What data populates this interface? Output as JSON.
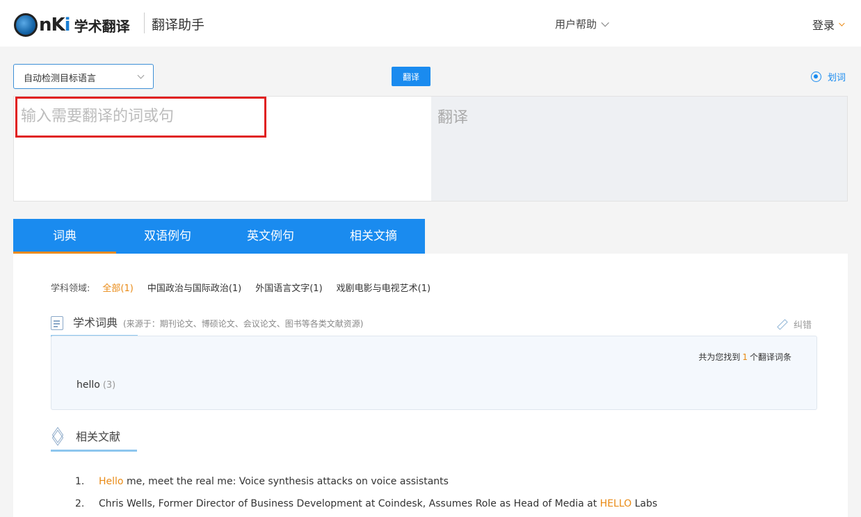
{
  "header": {
    "logo_cnki": "nKi",
    "logo_text": "学术翻译",
    "app_title": "翻译助手",
    "help_menu": "用户帮助",
    "login": "登录"
  },
  "toolbar": {
    "language_select": "自动检测目标语言",
    "translate_button": "翻译",
    "word_select_label": "划词"
  },
  "source": {
    "placeholder": "输入需要翻译的词或句",
    "value": ""
  },
  "output": {
    "placeholder": "翻译"
  },
  "tabs": [
    {
      "label": "词典",
      "active": true
    },
    {
      "label": "双语例句",
      "active": false
    },
    {
      "label": "英文例句",
      "active": false
    },
    {
      "label": "相关文摘",
      "active": false
    }
  ],
  "filters": {
    "label": "学科领域:",
    "items": [
      {
        "label": "全部(1)",
        "active": true
      },
      {
        "label": "中国政治与国际政治(1)",
        "active": false
      },
      {
        "label": "外国语言文字(1)",
        "active": false
      },
      {
        "label": "戏剧电影与电视艺术(1)",
        "active": false
      }
    ]
  },
  "dictionary": {
    "title": "学术词典",
    "source_note": "(来源于：期刊论文、博硕论文、会议论文、图书等各类文献资源)",
    "correct_label": "纠错",
    "found_prefix": "共为您找到",
    "found_count": "1",
    "found_suffix": "个翻译词条",
    "entry_word": "hello",
    "entry_count": "(3)"
  },
  "related": {
    "title": "相关文献",
    "items": [
      {
        "index": "1.",
        "highlight": "Hello",
        "rest": " me, meet the real me: Voice synthesis attacks on voice assistants"
      },
      {
        "index": "2.",
        "prefix": "Chris Wells, Former Director of Business Development at Coindesk, Assumes Role as Head of Media at ",
        "highlight": "HELLO",
        "suffix": " Labs"
      }
    ]
  },
  "colors": {
    "accent_blue": "#1a8bef",
    "accent_orange": "#e98a15",
    "highlight_red": "#e02020"
  }
}
